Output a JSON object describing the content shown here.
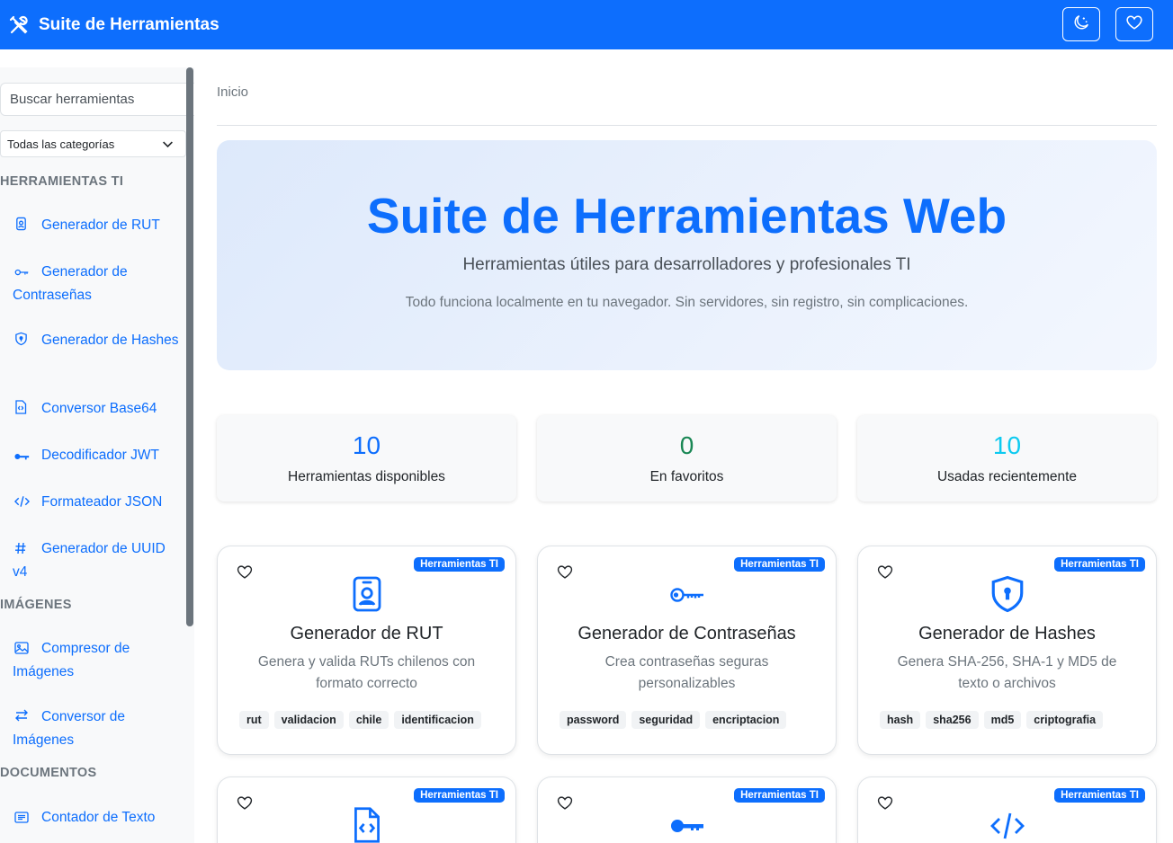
{
  "app": {
    "title": "Suite de Herramientas",
    "brand_icon": "tools-icon",
    "actions": [
      {
        "name": "theme-toggle",
        "icon": "moon-stars-icon"
      },
      {
        "name": "favorites",
        "icon": "heart-icon"
      }
    ]
  },
  "sidebar": {
    "search_placeholder": "Buscar herramientas",
    "category_select": "Todas las categorías",
    "sections": [
      {
        "title": "HERRAMIENTAS TI",
        "items": [
          {
            "label": "Generador de RUT",
            "icon": "person-badge-icon"
          },
          {
            "label": "Generador de Contraseñas",
            "icon": "key-icon"
          },
          {
            "label": "Generador de Hashes",
            "icon": "shield-lock-icon"
          },
          {
            "label": "Conversor Base64",
            "icon": "file-code-icon"
          },
          {
            "label": "Decodificador JWT",
            "icon": "key-fill-icon"
          },
          {
            "label": "Formateador JSON",
            "icon": "code-slash-icon"
          },
          {
            "label": "Generador de UUID v4",
            "icon": "hash-icon"
          }
        ]
      },
      {
        "title": "IMÁGENES",
        "items": [
          {
            "label": "Compresor de Imágenes",
            "icon": "image-icon"
          },
          {
            "label": "Conversor de Imágenes",
            "icon": "arrow-left-right-icon"
          }
        ]
      },
      {
        "title": "DOCUMENTOS",
        "items": [
          {
            "label": "Contador de Texto",
            "icon": "card-text-icon"
          }
        ]
      }
    ]
  },
  "breadcrumb": "Inicio",
  "hero": {
    "title": "Suite de Herramientas Web",
    "subtitle": "Herramientas útiles para desarrolladores y profesionales TI",
    "note": "Todo funciona localmente en tu navegador. Sin servidores, sin registro, sin complicaciones."
  },
  "stats": [
    {
      "value": "10",
      "label": "Herramientas disponibles",
      "color": "#0d6efd"
    },
    {
      "value": "0",
      "label": "En favoritos",
      "color": "#198754"
    },
    {
      "value": "10",
      "label": "Usadas recientemente",
      "color": "#0dcaf0"
    }
  ],
  "cards": [
    {
      "badge": "Herramientas TI",
      "icon": "person-badge-icon",
      "title": "Generador de RUT",
      "description": "Genera y valida RUTs chilenos con formato correcto",
      "tags": [
        "rut",
        "validacion",
        "chile",
        "identificacion"
      ]
    },
    {
      "badge": "Herramientas TI",
      "icon": "key-icon",
      "title": "Generador de Contraseñas",
      "description": "Crea contraseñas seguras personalizables",
      "tags": [
        "password",
        "seguridad",
        "encriptacion"
      ]
    },
    {
      "badge": "Herramientas TI",
      "icon": "shield-lock-icon",
      "title": "Generador de Hashes",
      "description": "Genera SHA-256, SHA-1 y MD5 de texto o archivos",
      "tags": [
        "hash",
        "sha256",
        "md5",
        "criptografia"
      ]
    },
    {
      "badge": "Herramientas TI",
      "icon": "file-code-icon"
    },
    {
      "badge": "Herramientas TI",
      "icon": "key-fill-icon"
    },
    {
      "badge": "Herramientas TI",
      "icon": "code-slash-icon"
    }
  ],
  "colors": {
    "primary": "#0d6efd",
    "success": "#198754",
    "info": "#0dcaf0",
    "muted": "#6c757d"
  }
}
